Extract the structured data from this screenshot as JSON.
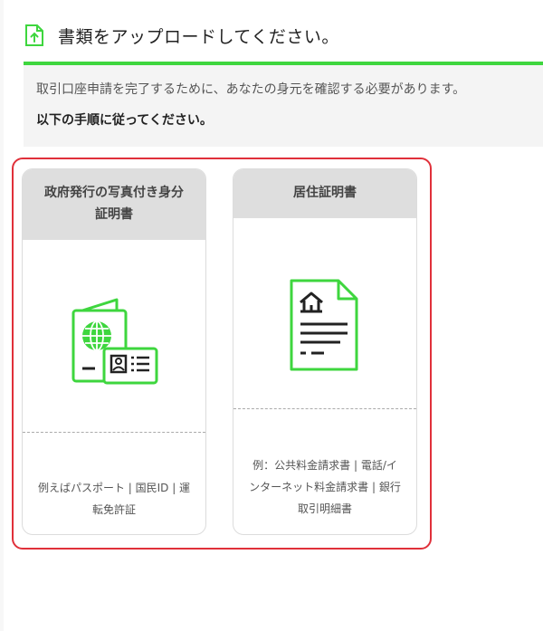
{
  "header": {
    "title": "書類をアップロードしてください。",
    "icon": "upload-document-icon"
  },
  "info": {
    "line1": "取引口座申請を完了するために、あなたの身元を確認する必要があります。",
    "line2": "以下の手順に従ってください。"
  },
  "colors": {
    "accent_green": "#3ed63e",
    "highlight_red": "#e0303a",
    "card_header_bg": "#dedede"
  },
  "cards": [
    {
      "title_line1": "政府発行の写真付き身分",
      "title_line2": "証明書",
      "icon": "passport-id-card-icon",
      "examples_line1": "例えばパスポート | 国民ID | 運",
      "examples_line2": "転免許証"
    },
    {
      "title_line1": "居住証明書",
      "icon": "address-document-icon",
      "examples_line1": "例：公共料金請求書 | 電話/イ",
      "examples_line2": "ンターネット料金請求書 | 銀行",
      "examples_line3": "取引明細書"
    }
  ]
}
